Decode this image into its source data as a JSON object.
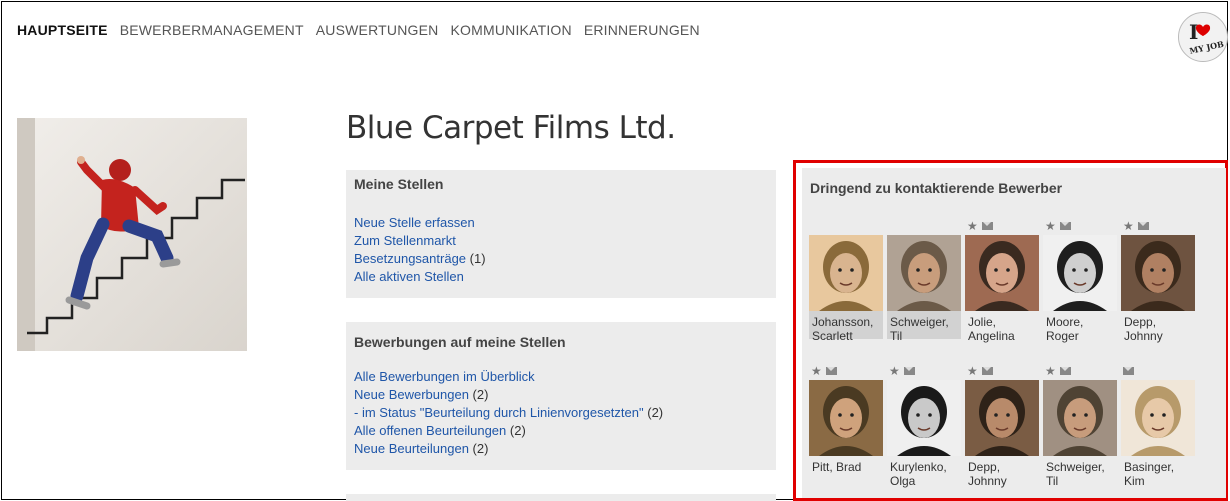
{
  "nav": {
    "items": [
      {
        "label": "HAUPTSEITE",
        "active": true
      },
      {
        "label": "BEWERBERMANAGEMENT",
        "active": false
      },
      {
        "label": "AUSWERTUNGEN",
        "active": false
      },
      {
        "label": "KOMMUNIKATION",
        "active": false
      },
      {
        "label": "ERINNERUNGEN",
        "active": false
      }
    ]
  },
  "logo": {
    "text_top": "I",
    "text_bottom": "MY JOB"
  },
  "company": {
    "name": "Blue Carpet Films Ltd."
  },
  "panels": {
    "stellen": {
      "title": "Meine Stellen",
      "links": [
        {
          "label": "Neue Stelle erfassen",
          "count": ""
        },
        {
          "label": "Zum Stellenmarkt",
          "count": ""
        },
        {
          "label": "Besetzungsanträge",
          "count": "(1)"
        },
        {
          "label": "Alle aktiven Stellen",
          "count": ""
        }
      ]
    },
    "bewerbungen": {
      "title": "Bewerbungen auf meine Stellen",
      "links": [
        {
          "label": "Alle Bewerbungen im Überblick",
          "count": ""
        },
        {
          "label": "Neue Bewerbungen",
          "count": "(2)"
        },
        {
          "label": "- im Status \"Beurteilung durch Linienvorgesetzten\"",
          "count": "(2)"
        },
        {
          "label": "Alle offenen Beurteilungen",
          "count": "(2)"
        },
        {
          "label": "Neue Beurteilungen",
          "count": "(2)"
        }
      ]
    }
  },
  "urgent": {
    "title": "Dringend zu kontaktierende Bewerber",
    "candidates": [
      {
        "line1": "Johansson,",
        "line2": "Scarlett",
        "star": false,
        "mail": false,
        "shade": true
      },
      {
        "line1": "Schweiger,",
        "line2": "Til",
        "star": false,
        "mail": false,
        "shade": true
      },
      {
        "line1": "Jolie,",
        "line2": "Angelina",
        "star": true,
        "mail": true,
        "shade": false
      },
      {
        "line1": "Moore,",
        "line2": "Roger",
        "star": true,
        "mail": true,
        "shade": false
      },
      {
        "line1": "Depp,",
        "line2": "Johnny",
        "star": true,
        "mail": true,
        "shade": false
      },
      {
        "line1": "Pitt, Brad",
        "line2": "",
        "star": true,
        "mail": true,
        "shade": false
      },
      {
        "line1": "Kurylenko,",
        "line2": "Olga",
        "star": true,
        "mail": true,
        "shade": false
      },
      {
        "line1": "Depp,",
        "line2": "Johnny",
        "star": true,
        "mail": true,
        "shade": false
      },
      {
        "line1": "Schweiger,",
        "line2": "Til",
        "star": true,
        "mail": true,
        "shade": false
      },
      {
        "line1": "Basinger,",
        "line2": "Kim",
        "star": false,
        "mail": true,
        "shade": false
      }
    ]
  },
  "colors": {
    "accent_red": "#e00000",
    "link_blue": "#1f56a8",
    "panel_bg": "#ececec"
  }
}
